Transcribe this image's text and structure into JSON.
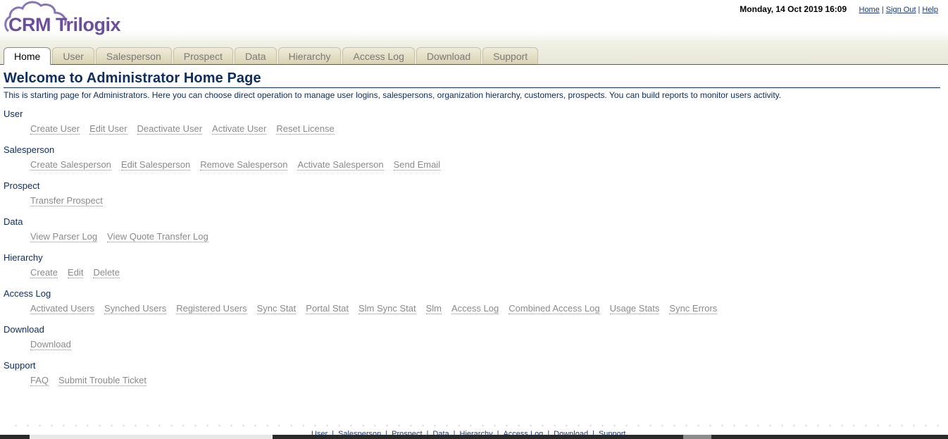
{
  "header": {
    "logo_text": "CRM Trilogix",
    "datetime": "Monday, 14 Oct 2019 16:09",
    "links": [
      "Home",
      "Sign Out",
      "Help"
    ]
  },
  "tabs": [
    "Home",
    "User",
    "Salesperson",
    "Prospect",
    "Data",
    "Hierarchy",
    "Access Log",
    "Download",
    "Support"
  ],
  "active_tab": "Home",
  "page": {
    "title": "Welcome to Administrator Home Page",
    "intro": "This is starting page for Administrators. Here you can choose direct operation to manage user logins, salespersons, organization hierarchy, customers, prospects. You can build reports to monitor users activity."
  },
  "sections": [
    {
      "title": "User",
      "links": [
        "Create User",
        "Edit User",
        "Deactivate User",
        "Activate User",
        "Reset License"
      ]
    },
    {
      "title": "Salesperson",
      "links": [
        "Create Salesperson",
        "Edit Salesperson",
        "Remove Salesperson",
        "Activate Salesperson",
        "Send Email"
      ]
    },
    {
      "title": "Prospect",
      "links": [
        "Transfer Prospect"
      ]
    },
    {
      "title": "Data",
      "links": [
        "View Parser Log",
        "View Quote Transfer Log"
      ]
    },
    {
      "title": "Hierarchy",
      "links": [
        "Create",
        "Edit",
        "Delete"
      ]
    },
    {
      "title": "Access Log",
      "links": [
        "Activated Users",
        "Synched Users",
        "Registered Users",
        "Sync Stat",
        "Portal Stat",
        "Slm Sync Stat",
        "Slm",
        "Access Log",
        "Combined Access Log",
        "Usage Stats",
        "Sync Errors"
      ]
    },
    {
      "title": "Download",
      "links": [
        "Download"
      ]
    },
    {
      "title": "Support",
      "links": [
        "FAQ",
        "Submit Trouble Ticket"
      ]
    }
  ],
  "footer": {
    "links": [
      "User",
      "Salesperson",
      "Prospect",
      "Data",
      "Hierarchy",
      "Access Log",
      "Download",
      "Support"
    ]
  },
  "colors": {
    "brand": "#6b4f9e",
    "title": "#0d2e62",
    "link_gray": "#8a8a8a"
  }
}
